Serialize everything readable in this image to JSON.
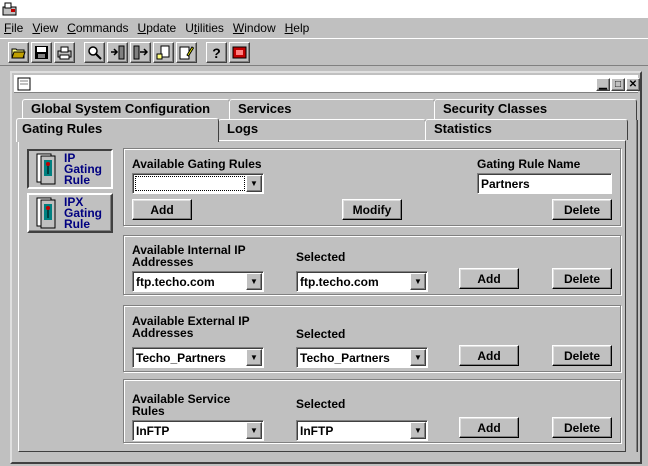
{
  "menu": [
    "File",
    "View",
    "Commands",
    "Update",
    "Utilities",
    "Window",
    "Help"
  ],
  "menu_underline": [
    "F",
    "V",
    "C",
    "U",
    "t",
    "W",
    "H"
  ],
  "menu_rest": [
    "ile",
    "iew",
    "ommands",
    "pdate",
    "ilities",
    "indow",
    "elp"
  ],
  "menu_pre": [
    "",
    "",
    "",
    "",
    "U",
    "",
    ""
  ],
  "tabs": {
    "global": "Global System Configuration",
    "services": "Services",
    "security": "Security Classes",
    "gating": "Gating Rules",
    "logs": "Logs",
    "statistics": "Statistics"
  },
  "sidebar": {
    "ip": [
      "IP",
      "Gating",
      "Rule"
    ],
    "ipx": [
      "IPX",
      "Gating",
      "Rule"
    ]
  },
  "gating": {
    "available_label": "Available Gating Rules",
    "available_value": "",
    "name_label": "Gating Rule Name",
    "name_value": "Partners",
    "add": "Add",
    "modify": "Modify",
    "delete": "Delete"
  },
  "internal": {
    "label1": "Available Internal IP",
    "label2": "Addresses",
    "selected_label": "Selected",
    "available_value": "ftp.techo.com",
    "selected_value": "ftp.techo.com",
    "add": "Add",
    "delete": "Delete"
  },
  "external": {
    "label1": "Available External IP",
    "label2": "Addresses",
    "selected_label": "Selected",
    "available_value": "Techo_Partners",
    "selected_value": "Techo_Partners",
    "add": "Add",
    "delete": "Delete"
  },
  "service": {
    "label1": "Available Service",
    "label2": "Rules",
    "selected_label": "Selected",
    "available_value": "InFTP",
    "selected_value": "InFTP",
    "add": "Add",
    "delete": "Delete"
  },
  "colors": {
    "face": "#c0c0c0",
    "shadow": "#808080",
    "highlight": "#ffffff",
    "accent": "#000080"
  }
}
